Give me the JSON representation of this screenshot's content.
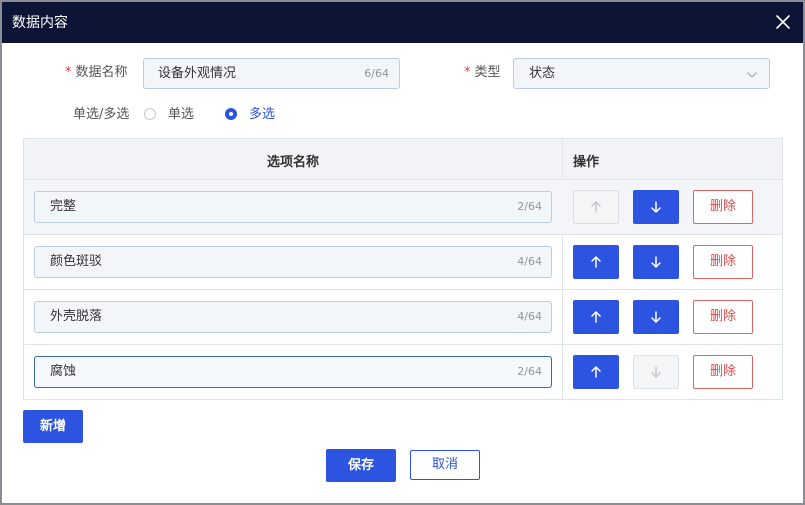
{
  "dialog": {
    "title": "数据内容"
  },
  "form": {
    "name_label": "数据名称",
    "name_value": "设备外观情况",
    "name_count": "6/64",
    "type_label": "类型",
    "type_value": "状态",
    "mode_label": "单选/多选",
    "mode_options": [
      "单选",
      "多选"
    ],
    "mode_selected": "多选"
  },
  "table": {
    "col_name": "选项名称",
    "col_op": "操作",
    "rows": [
      {
        "value": "完整",
        "count": "2/64",
        "up_enabled": false,
        "down_enabled": true,
        "delete_label": "删除"
      },
      {
        "value": "颜色斑驳",
        "count": "4/64",
        "up_enabled": true,
        "down_enabled": true,
        "delete_label": "删除"
      },
      {
        "value": "外壳脱落",
        "count": "4/64",
        "up_enabled": true,
        "down_enabled": true,
        "delete_label": "删除"
      },
      {
        "value": "腐蚀",
        "count": "2/64",
        "up_enabled": true,
        "down_enabled": false,
        "delete_label": "删除"
      }
    ]
  },
  "footer": {
    "add_label": "新增",
    "save_label": "保存",
    "cancel_label": "取消"
  },
  "icons": {
    "close": "close-icon",
    "dropdown": "chevron-down-icon",
    "up": "arrow-up-icon",
    "down": "arrow-down-icon"
  },
  "colors": {
    "header_bg": "#0c1535",
    "primary": "#2c54e0",
    "danger": "#e04848",
    "required": "#e0403a"
  }
}
